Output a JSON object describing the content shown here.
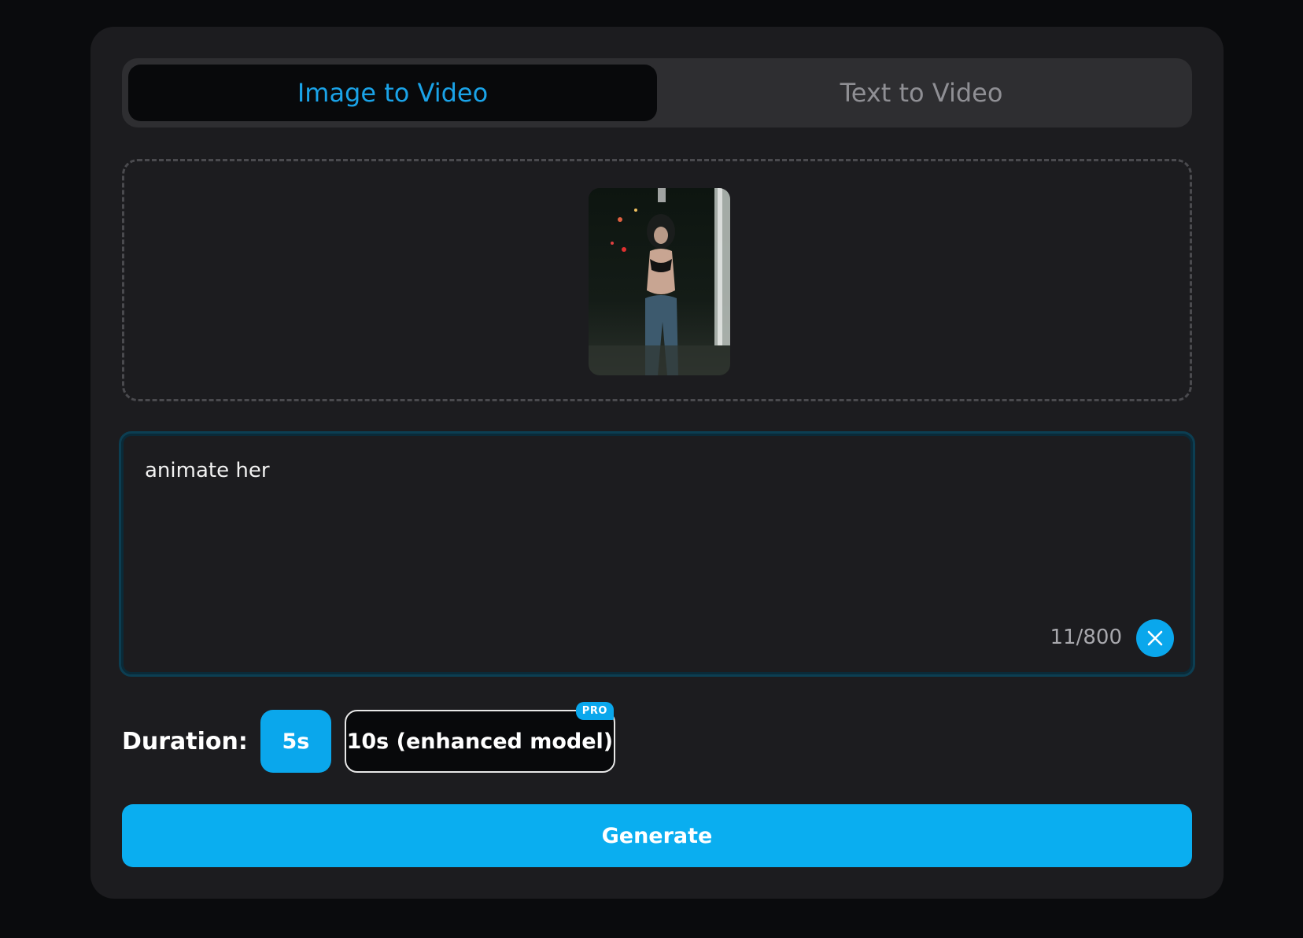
{
  "tabs": [
    {
      "label": "Image to Video",
      "active": true
    },
    {
      "label": "Text to Video",
      "active": false
    }
  ],
  "upload": {
    "thumbnail_icon": "uploaded-image-thumbnail"
  },
  "prompt": {
    "value": "animate her",
    "counter": "11/800",
    "clear_icon": "close-icon"
  },
  "duration": {
    "label": "Duration:",
    "options": [
      {
        "label": "5s",
        "selected": true
      },
      {
        "label": "10s (enhanced model)",
        "selected": false,
        "badge": "PRO"
      }
    ]
  },
  "generate": {
    "label": "Generate"
  },
  "colors": {
    "accent": "#0aa7ec",
    "active_tab_text": "#1aa3e8",
    "card_bg": "#1c1c1f",
    "page_bg": "#0a0b0d"
  }
}
